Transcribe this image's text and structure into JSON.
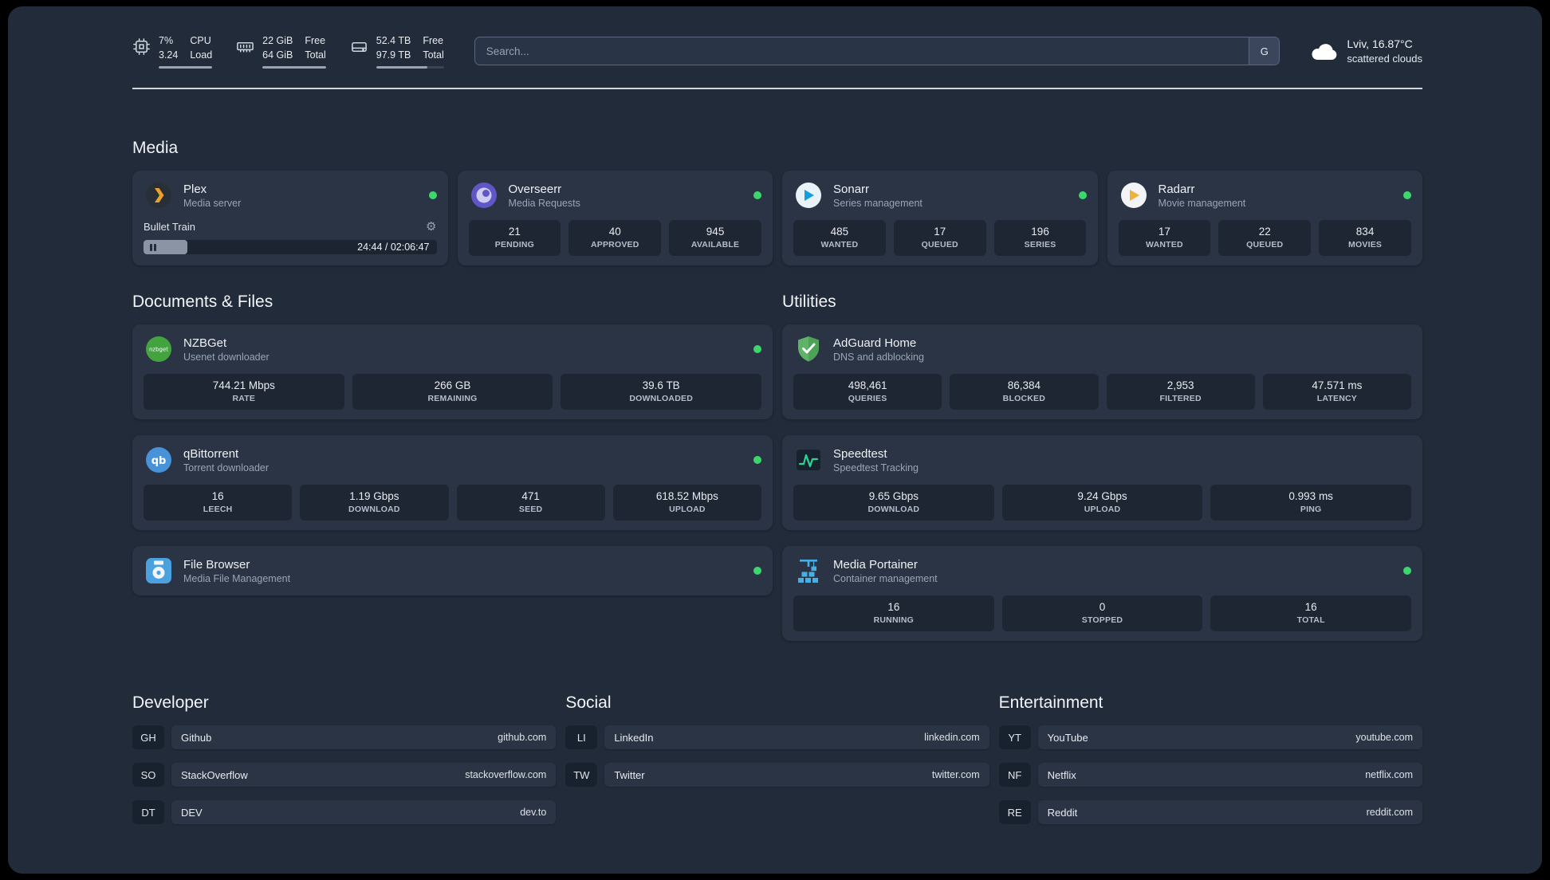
{
  "topbar": {
    "cpu": {
      "values": [
        "7%",
        "3.24"
      ],
      "labels": [
        "CPU",
        "Load"
      ]
    },
    "memory": {
      "values": [
        "22 GiB",
        "64 GiB"
      ],
      "labels": [
        "Free",
        "Total"
      ]
    },
    "disk": {
      "values": [
        "52.4 TB",
        "97.9 TB"
      ],
      "labels": [
        "Free",
        "Total"
      ]
    },
    "search": {
      "placeholder": "Search...",
      "shortcut": "G"
    },
    "weather": {
      "location": "Lviv, 16.87°C",
      "condition": "scattered clouds"
    }
  },
  "media": {
    "title": "Media",
    "plex": {
      "title": "Plex",
      "subtitle": "Media server",
      "now_playing": "Bullet Train",
      "time": "24:44 / 02:06:47"
    },
    "overseerr": {
      "title": "Overseerr",
      "subtitle": "Media Requests",
      "stats": [
        {
          "value": "21",
          "label": "PENDING"
        },
        {
          "value": "40",
          "label": "APPROVED"
        },
        {
          "value": "945",
          "label": "AVAILABLE"
        }
      ]
    },
    "sonarr": {
      "title": "Sonarr",
      "subtitle": "Series management",
      "stats": [
        {
          "value": "485",
          "label": "WANTED"
        },
        {
          "value": "17",
          "label": "QUEUED"
        },
        {
          "value": "196",
          "label": "SERIES"
        }
      ]
    },
    "radarr": {
      "title": "Radarr",
      "subtitle": "Movie management",
      "stats": [
        {
          "value": "17",
          "label": "WANTED"
        },
        {
          "value": "22",
          "label": "QUEUED"
        },
        {
          "value": "834",
          "label": "MOVIES"
        }
      ]
    }
  },
  "documents": {
    "title": "Documents & Files",
    "nzbget": {
      "title": "NZBGet",
      "subtitle": "Usenet downloader",
      "stats": [
        {
          "value": "744.21 Mbps",
          "label": "RATE"
        },
        {
          "value": "266 GB",
          "label": "REMAINING"
        },
        {
          "value": "39.6 TB",
          "label": "DOWNLOADED"
        }
      ]
    },
    "qbittorrent": {
      "title": "qBittorrent",
      "subtitle": "Torrent downloader",
      "stats": [
        {
          "value": "16",
          "label": "LEECH"
        },
        {
          "value": "1.19 Gbps",
          "label": "DOWNLOAD"
        },
        {
          "value": "471",
          "label": "SEED"
        },
        {
          "value": "618.52 Mbps",
          "label": "UPLOAD"
        }
      ]
    },
    "filebrowser": {
      "title": "File Browser",
      "subtitle": "Media File Management"
    }
  },
  "utilities": {
    "title": "Utilities",
    "adguard": {
      "title": "AdGuard Home",
      "subtitle": "DNS and adblocking",
      "stats": [
        {
          "value": "498,461",
          "label": "QUERIES"
        },
        {
          "value": "86,384",
          "label": "BLOCKED"
        },
        {
          "value": "2,953",
          "label": "FILTERED"
        },
        {
          "value": "47.571 ms",
          "label": "LATENCY"
        }
      ]
    },
    "speedtest": {
      "title": "Speedtest",
      "subtitle": "Speedtest Tracking",
      "stats": [
        {
          "value": "9.65 Gbps",
          "label": "DOWNLOAD"
        },
        {
          "value": "9.24 Gbps",
          "label": "UPLOAD"
        },
        {
          "value": "0.993 ms",
          "label": "PING"
        }
      ]
    },
    "portainer": {
      "title": "Media Portainer",
      "subtitle": "Container management",
      "stats": [
        {
          "value": "16",
          "label": "RUNNING"
        },
        {
          "value": "0",
          "label": "STOPPED"
        },
        {
          "value": "16",
          "label": "TOTAL"
        }
      ]
    }
  },
  "bookmarks": {
    "developer": {
      "title": "Developer",
      "items": [
        {
          "abbr": "GH",
          "name": "Github",
          "url": "github.com"
        },
        {
          "abbr": "SO",
          "name": "StackOverflow",
          "url": "stackoverflow.com"
        },
        {
          "abbr": "DT",
          "name": "DEV",
          "url": "dev.to"
        }
      ]
    },
    "social": {
      "title": "Social",
      "items": [
        {
          "abbr": "LI",
          "name": "LinkedIn",
          "url": "linkedin.com"
        },
        {
          "abbr": "TW",
          "name": "Twitter",
          "url": "twitter.com"
        }
      ]
    },
    "entertainment": {
      "title": "Entertainment",
      "items": [
        {
          "abbr": "YT",
          "name": "YouTube",
          "url": "youtube.com"
        },
        {
          "abbr": "NF",
          "name": "Netflix",
          "url": "netflix.com"
        },
        {
          "abbr": "RE",
          "name": "Reddit",
          "url": "reddit.com"
        }
      ]
    }
  },
  "icons": {
    "gear-icon": "⚙",
    "pause-icon": "❚❚",
    "status-dot": "●",
    "cpu-icon": "chip",
    "memory-icon": "ram-stick",
    "disk-icon": "hard-drive",
    "cloud-icon": "cloud"
  },
  "colors": {
    "background": "#222b3a",
    "card": "#2b3444",
    "stat_box": "#1c2432",
    "status_online": "#3cd66d",
    "divider": "#eaeef3",
    "accent_plex": "#e8a22c"
  }
}
